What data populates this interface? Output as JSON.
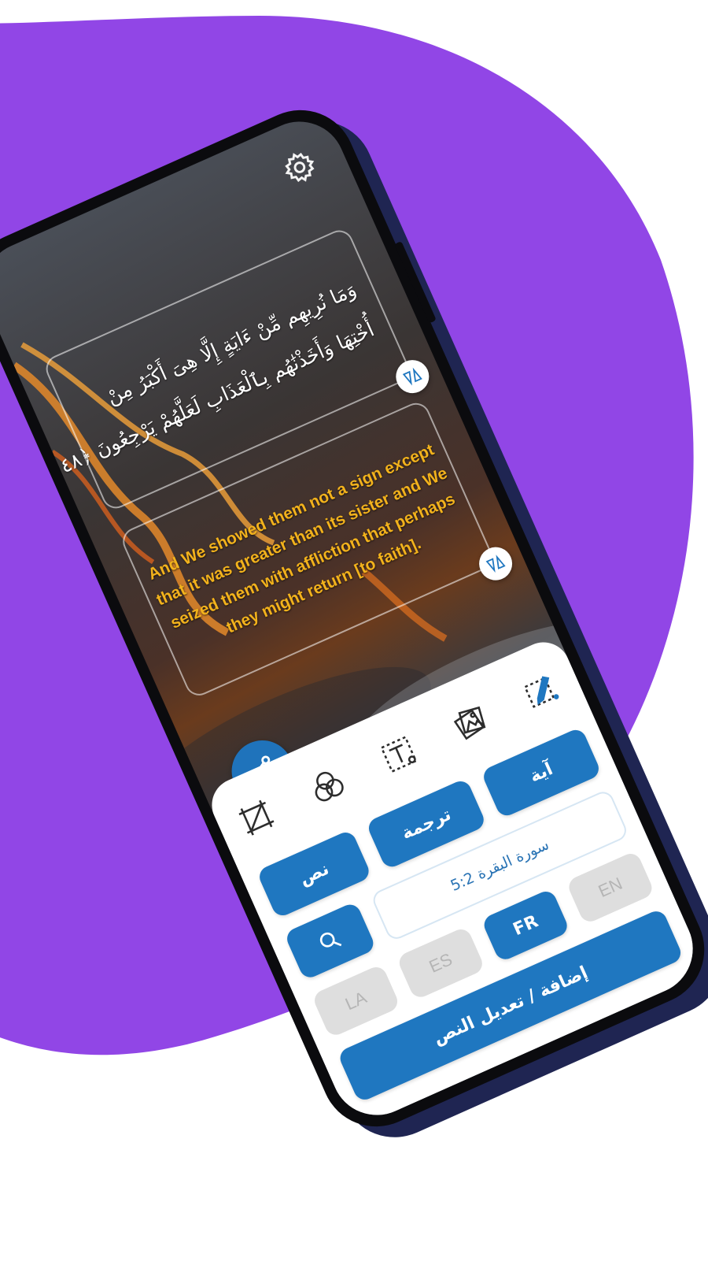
{
  "colors": {
    "background_blob": "#9146e6",
    "accent_blue": "#1f77c0",
    "translation_text": "#f2b21c",
    "disabled_grey": "#dedede"
  },
  "settings": {
    "icon": "gear-icon"
  },
  "verse": {
    "arabic_lines": [
      "وَمَا نُرِيهِم مِّنْ ءَايَةٍ إِلَّا هِىَ أَكْبَرُ مِنْ",
      "أُخْتِهَا وَأَخَذْنَٰهُم بِٱلْعَذَابِ لَعَلَّهُمْ يَرْجِعُونَ ﴿٤٨﴾"
    ],
    "translation_lines": [
      "And We showed them not a sign except",
      "that it was greater than its sister and We",
      "seized them with affliction that perhaps",
      "they might return [to faith]."
    ]
  },
  "share": {
    "icon": "share-icon"
  },
  "tools": [
    {
      "icon": "crop-frame-icon"
    },
    {
      "icon": "color-circles-icon"
    },
    {
      "icon": "text-format-icon"
    },
    {
      "icon": "image-gallery-icon"
    },
    {
      "icon": "edit-pen-icon"
    }
  ],
  "mode_buttons": {
    "verse": "آية",
    "translation": "ترجمة",
    "text": "نص"
  },
  "surah_field": {
    "value": "سورة البقرة 5:2"
  },
  "search": {
    "icon": "search-icon"
  },
  "languages": {
    "en": "EN",
    "fr": "FR",
    "es": "ES",
    "la": "LA",
    "selected": "FR"
  },
  "primary_action": {
    "label": "إضافة / تعديل النص"
  }
}
